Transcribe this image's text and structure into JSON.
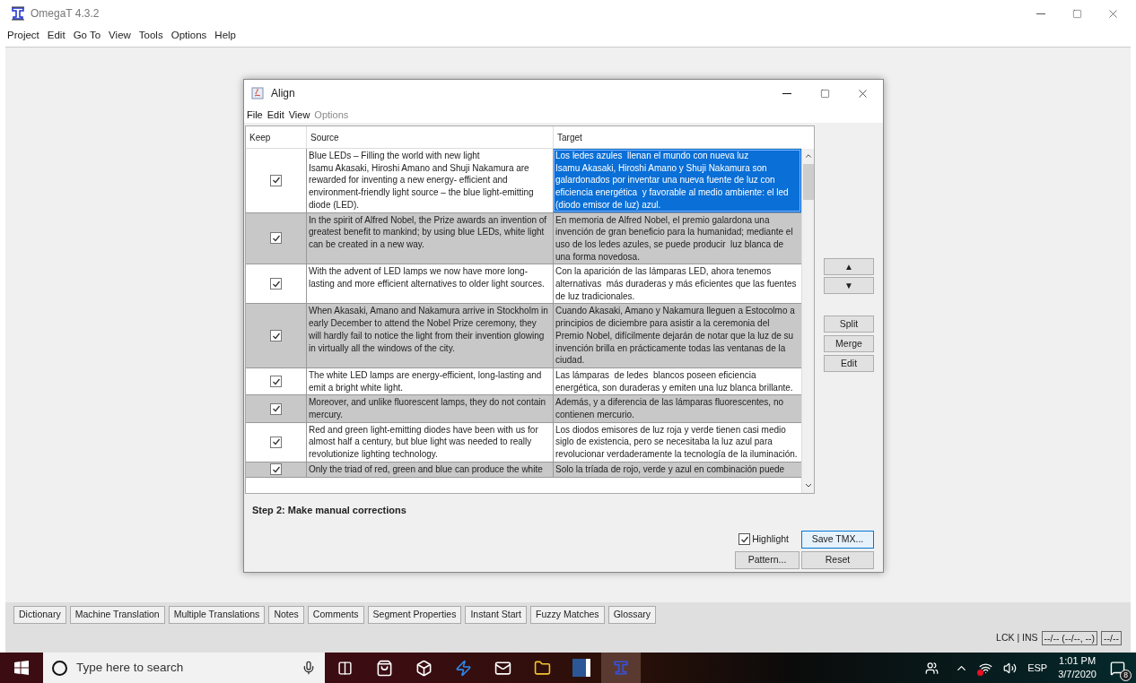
{
  "app": {
    "title": "OmegaT 4.3.2",
    "menu": [
      "Project",
      "Edit",
      "Go To",
      "View",
      "Tools",
      "Options",
      "Help"
    ]
  },
  "dialog": {
    "title": "Align",
    "menu": [
      {
        "label": "File",
        "disabled": false
      },
      {
        "label": "Edit",
        "disabled": false
      },
      {
        "label": "View",
        "disabled": false
      },
      {
        "label": "Options",
        "disabled": true
      }
    ],
    "columns": [
      "Keep",
      "Source",
      "Target"
    ],
    "rows": [
      {
        "keep": true,
        "selected": true,
        "source": "Blue LEDs – Filling the world with new light\nIsamu Akasaki, Hiroshi Amano and Shuji Nakamura are rewarded for inventing a new energy- efficient and environment-friendly light source – the blue light-emitting diode (LED).",
        "target": "Los ledes azules  llenan el mundo con nueva luz\nIsamu Akasaki, Hiroshi Amano y Shuji Nakamura son galardonados por inventar una nueva fuente de luz con eficiencia energética  y favorable al medio ambiente: el led (diodo emisor de luz) azul."
      },
      {
        "keep": true,
        "selected": false,
        "source": "In the spirit of Alfred Nobel, the Prize awards an invention of greatest benefit to mankind; by using blue LEDs, white light can be created in a new way.",
        "target": "En memoria de Alfred Nobel, el premio galardona una invención de gran beneficio para la humanidad; mediante el uso de los ledes azules, se puede producir  luz blanca de una forma novedosa."
      },
      {
        "keep": true,
        "selected": false,
        "source": "With the advent of LED lamps we now have more long-lasting and more efficient alternatives to older light sources.",
        "target": "Con la aparición de las lámparas LED, ahora tenemos alternativas  más duraderas y más eficientes que las fuentes de luz tradicionales."
      },
      {
        "keep": true,
        "selected": false,
        "source": "When Akasaki, Amano and Nakamura arrive in Stockholm in early December to attend the Nobel Prize ceremony, they will hardly fail to notice the light from their invention glowing in virtually all the windows of the city.",
        "target": "Cuando Akasaki, Amano y Nakamura lleguen a Estocolmo a principios de diciembre para asistir a la ceremonia del Premio Nobel, difícilmente dejarán de notar que la luz de su invención brilla en prácticamente todas las ventanas de la ciudad."
      },
      {
        "keep": true,
        "selected": false,
        "source": "The white LED lamps are energy-efficient, long-lasting and emit a bright white light.",
        "target": "Las lámparas  de ledes  blancos poseen eficiencia energética, son duraderas y emiten una luz blanca brillante."
      },
      {
        "keep": true,
        "selected": false,
        "source": "Moreover, and unlike fluorescent lamps, they do not contain mercury.",
        "target": "Además, y a diferencia de las lámparas fluorescentes, no contienen mercurio."
      },
      {
        "keep": true,
        "selected": false,
        "source": "Red and green light-emitting diodes have been with us for almost half a century, but blue light was needed to really revolutionize lighting technology.",
        "target": "Los diodos emisores de luz roja y verde tienen casi medio siglo de existencia, pero se necesitaba la luz azul para revolucionar verdaderamente la tecnología de la iluminación."
      },
      {
        "keep": true,
        "selected": false,
        "source": "Only the triad of red, green and blue can produce the white",
        "target": "Solo la tríada de rojo, verde y azul en combinación puede"
      }
    ],
    "nav_buttons": [
      "▲",
      "▼"
    ],
    "edit_buttons": [
      "Split",
      "Merge",
      "Edit"
    ],
    "step_label": "Step 2: Make manual corrections",
    "highlight": {
      "label": "Highlight",
      "checked": true
    },
    "buttons": [
      {
        "label": "Save TMX...",
        "focused": true
      },
      {
        "label": "Pattern...",
        "focused": false
      },
      {
        "label": "Reset",
        "focused": false
      }
    ]
  },
  "bottom_tabs": [
    "Dictionary",
    "Machine Translation",
    "Multiple Translations",
    "Notes",
    "Comments",
    "Segment Properties",
    "Instant Start",
    "Fuzzy Matches",
    "Glossary"
  ],
  "status": {
    "mode": "LCK | INS",
    "fields": [
      "--/-- (--/--, --)",
      "--/--"
    ]
  },
  "taskbar": {
    "search_placeholder": "Type here to search",
    "language": "ESP",
    "time": "1:01 PM",
    "date": "3/7/2020",
    "notification_count": "8"
  }
}
